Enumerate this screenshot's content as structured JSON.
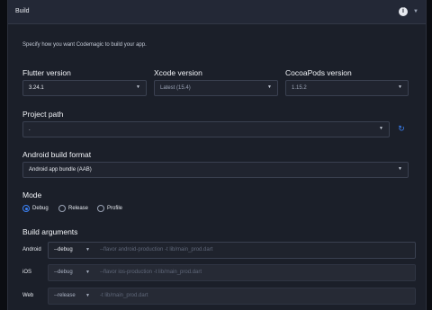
{
  "header": {
    "title": "Build",
    "info_icon": "i",
    "collapse_icon": "chevron-down"
  },
  "description": "Specify how you want Codemagic to build your app.",
  "versions": {
    "flutter": {
      "label": "Flutter version",
      "value": "3.24.1"
    },
    "xcode": {
      "label": "Xcode version",
      "value": "Latest (15.4)"
    },
    "cocoapods": {
      "label": "CocoaPods version",
      "value": "1.15.2"
    }
  },
  "project_path": {
    "label": "Project path",
    "value": "."
  },
  "android_format": {
    "label": "Android build format",
    "value": "Android app bundle (AAB)"
  },
  "mode": {
    "label": "Mode",
    "options": [
      {
        "label": "Debug",
        "selected": true
      },
      {
        "label": "Release",
        "selected": false
      },
      {
        "label": "Profile",
        "selected": false
      }
    ]
  },
  "build_arguments": {
    "label": "Build arguments",
    "rows": [
      {
        "platform": "Android",
        "mode": "--debug",
        "placeholder": "--flavor android-production -t lib/main_prod.dart"
      },
      {
        "platform": "iOS",
        "mode": "--debug",
        "placeholder": "--flavor ios-production -t lib/main_prod.dart"
      },
      {
        "platform": "Web",
        "mode": "--release",
        "placeholder": "-t lib/main_prod.dart"
      }
    ]
  },
  "colors": {
    "accent": "#3b82f6",
    "panel": "#1b1f29",
    "background": "#0b0d12"
  }
}
